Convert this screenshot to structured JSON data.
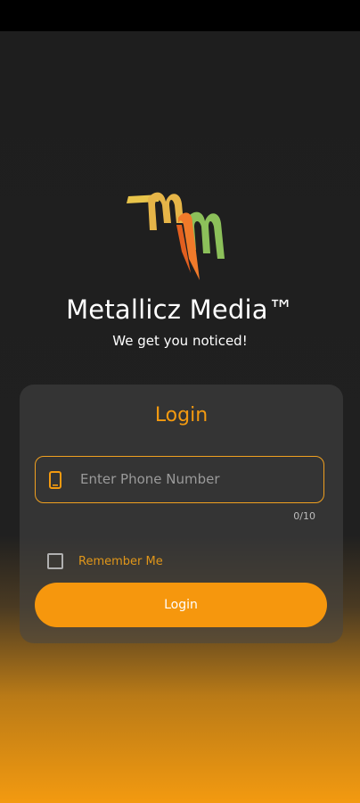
{
  "app": {
    "brand_name": "Metallicz Media™",
    "tagline": "We get you noticed!",
    "logo_icon": "mm-logo-icon"
  },
  "login_card": {
    "title": "Login",
    "phone_field": {
      "icon": "phone-icon",
      "placeholder": "Enter Phone Number",
      "value": "",
      "counter": "0/10"
    },
    "remember_me": {
      "label": "Remember Me",
      "checked": false
    },
    "login_button_label": "Login"
  },
  "colors": {
    "accent": "#f39a10",
    "logo_yellow": "#e8c44a",
    "logo_orange": "#f07a2a",
    "logo_green": "#8cc05a"
  }
}
